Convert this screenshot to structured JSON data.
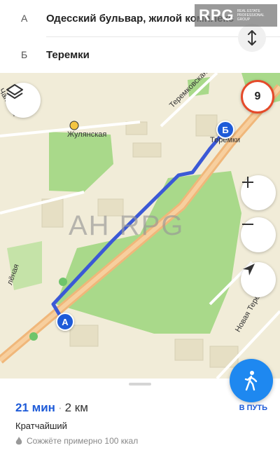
{
  "route": {
    "from_letter": "А",
    "from_text": "Одесский бульвар, жилой комплекс",
    "to_letter": "Б",
    "to_text": "Теремки"
  },
  "logo": {
    "text": "RPG",
    "tagline": "REAL ESTATE PROFESSIONAL GROUP"
  },
  "map": {
    "watermark": "АН RPG",
    "speed_limit": "9",
    "marker_a": "А",
    "marker_b": "Б",
    "streets": {
      "zhulyanskaya": "Жулянская",
      "teremkovskaya": "Теремковская",
      "teremki": "Теремки",
      "novaya_teremskaya": "Новая Теремская",
      "chapaeva": "Чапаева",
      "lenaya": "лёная"
    },
    "colors": {
      "park": "#a9d98a",
      "route": "#3b59d6",
      "highway": "#f0b77a",
      "land": "#f1ecd8"
    }
  },
  "sheet": {
    "time": "21 мин",
    "separator": "·",
    "distance": "2 км",
    "route_type": "Кратчайший",
    "calories": "Сожжёте примерно 100 ккал",
    "go_label": "В ПУТЬ"
  },
  "icons": {
    "layers": "layers-icon",
    "swap": "swap-icon",
    "zoom_in": "plus-icon",
    "zoom_out": "minus-icon",
    "locate": "location-arrow-icon",
    "walk": "walking-person-icon",
    "flame": "flame-icon"
  }
}
